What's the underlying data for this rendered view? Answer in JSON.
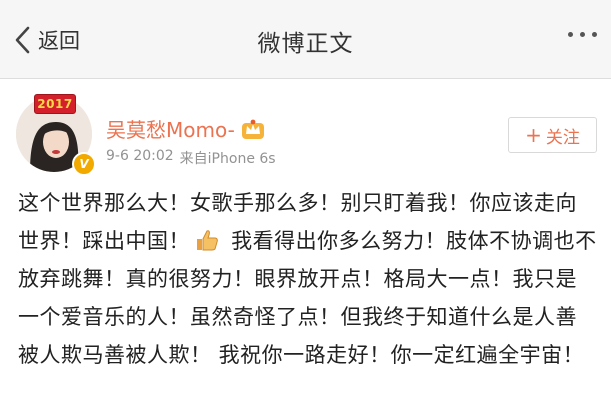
{
  "navbar": {
    "back_label": "返回",
    "title": "微博正文"
  },
  "post": {
    "avatar_badge": "2017",
    "verified_badge": "V",
    "username": "吴莫愁Momo-",
    "time": "9-6 20:02",
    "source": "来自iPhone 6s",
    "follow_label": "关注",
    "follow_plus": "+",
    "text_part1": "这个世界那么大！女歌手那么多！别只盯着我！你应该走向世界！踩出中国！",
    "emoji": "thumbs-up-icon",
    "text_part2": " 我看得出你多么努力！肢体不协调也不放弃跳舞！真的很努力！眼界放开点！格局大一点！我只是一个爱音乐的人！虽然奇怪了点！但我终于知道什么是人善被人欺马善被人欺！ 我祝你一路走好！你一定红遍全宇宙！"
  },
  "colors": {
    "accent": "#eb7350",
    "meta": "#929292",
    "navbar_bg": "#f6f6f6"
  }
}
